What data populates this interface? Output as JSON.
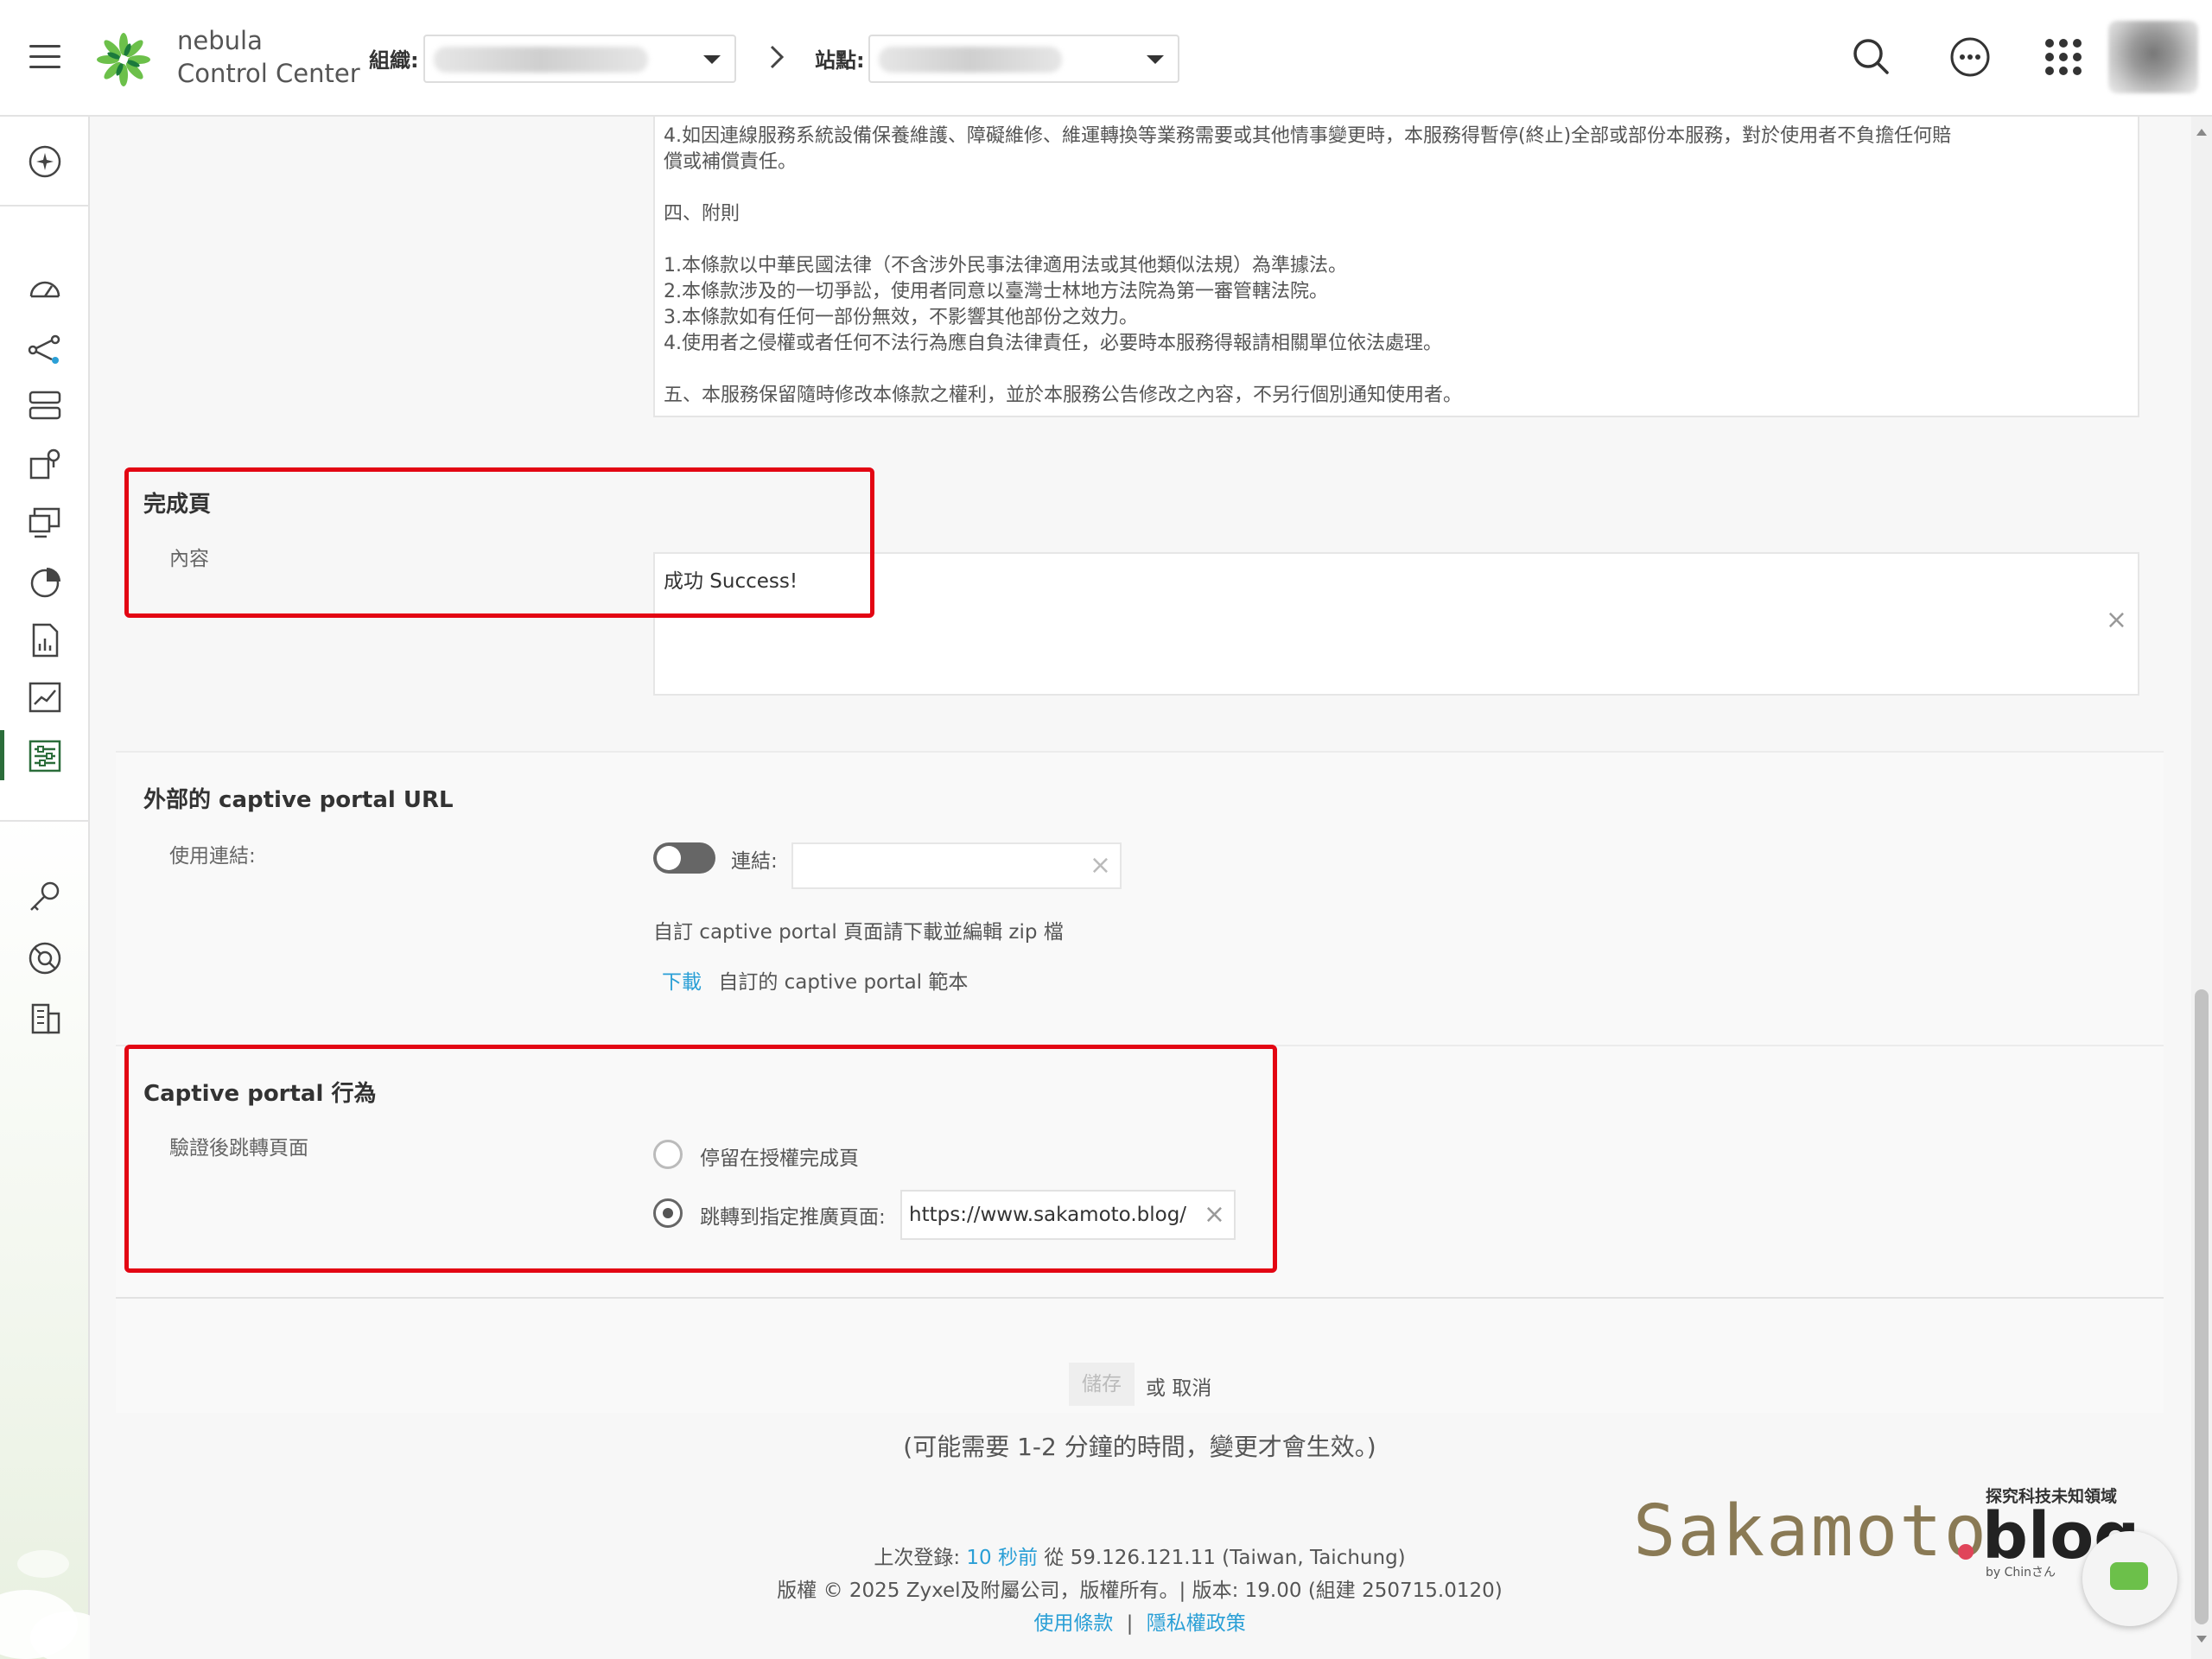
{
  "header": {
    "brand_line1": "nebula",
    "brand_line2": "Control Center",
    "org_label": "組織:",
    "site_label": "站點:"
  },
  "terms": {
    "lines": [
      "4.如因連線服務系統設備保養維護、障礙維修、維運轉換等業務需要或其他情事變更時，本服務得暫停(終止)全部或部份本服務，對於使用者不負擔任何賠",
      "償或補償責任。",
      "四、附則",
      "1.本條款以中華民國法律（不含涉外民事法律適用法或其他類似法規）為準據法。",
      "2.本條款涉及的一切爭訟，使用者同意以臺灣士林地方法院為第一審管轄法院。",
      "3.本條款如有任何一部份無效，不影響其他部份之效力。",
      "4.使用者之侵權或者任何不法行為應自負法律責任，必要時本服務得報請相關單位依法處理。",
      "五、本服務保留隨時修改本條款之權利，並於本服務公告修改之內容，不另行個別通知使用者。"
    ]
  },
  "success_page": {
    "title": "完成頁",
    "content_label": "內容",
    "content_value": "成功 Success!"
  },
  "external_url": {
    "title": "外部的 captive portal URL",
    "use_link_label": "使用連結:",
    "link_label": "連結:",
    "link_value": "",
    "custom_note": "自訂 captive portal 頁面請下載並編輯 zip 檔",
    "download_link": "下載",
    "download_suffix": "自訂的 captive portal 範本"
  },
  "behavior": {
    "title": "Captive portal 行為",
    "redirect_label": "驗證後跳轉頁面",
    "option_stay": "停留在授權完成頁",
    "option_redirect": "跳轉到指定推廣頁面:",
    "redirect_url": "https://www.sakamoto.blog/",
    "selected": "redirect"
  },
  "actions": {
    "save": "儲存",
    "or": "或",
    "cancel": "取消",
    "note": "(可能需要 1-2 分鐘的時間，變更才會生效。)"
  },
  "footer": {
    "last_login_prefix": "上次登錄:",
    "last_login_time": "10 秒前",
    "last_login_from": "從 59.126.121.11 (Taiwan, Taichung)",
    "copyright": "版權 © 2025 Zyxel及附屬公司，版權所有。| 版本: 19.00 (組建 250715.0120)",
    "terms_link": "使用條款",
    "separator": "|",
    "privacy_link": "隱私權政策"
  },
  "watermark": {
    "tagline": "探究科技未知領域",
    "name": "Sakamoto",
    "suffix": "blog",
    "byline": "by Chinさん"
  },
  "colors": {
    "accent_red": "#e30613",
    "link_blue": "#2a9fd6",
    "sidebar_active": "#2b6d3a"
  }
}
